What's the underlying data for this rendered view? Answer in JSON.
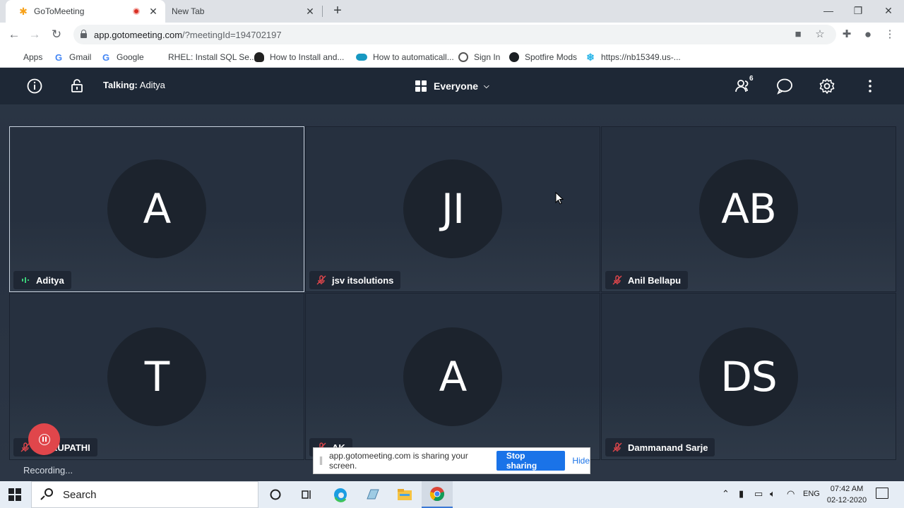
{
  "browser": {
    "tabs": [
      {
        "title": "GoToMeeting",
        "favicon": "gotomeeting-icon",
        "recording": true
      },
      {
        "title": "New Tab"
      }
    ],
    "new_tab": "+",
    "url_host": "app.gotomeeting.com",
    "url_path": "/?meetingId=194702197",
    "bookmarks": [
      {
        "label": "Apps",
        "icon": "apps-grid-icon"
      },
      {
        "label": "Gmail",
        "icon": "google-icon"
      },
      {
        "label": "Google",
        "icon": "google-icon"
      },
      {
        "label": "RHEL: Install SQL Se...",
        "icon": "windows-icon"
      },
      {
        "label": "How to Install and...",
        "icon": "linux-icon"
      },
      {
        "label": "How to automaticall...",
        "icon": "salesforce-icon"
      },
      {
        "label": "Sign In",
        "icon": "sign-in-icon"
      },
      {
        "label": "Spotfire Mods",
        "icon": "github-icon"
      },
      {
        "label": "https://nb15349.us-...",
        "icon": "snowflake-icon"
      }
    ]
  },
  "meeting": {
    "talking_label": "Talking:",
    "talking_name": "Aditya",
    "view_label": "Everyone",
    "attendee_count": "6",
    "participants": [
      {
        "initials": "A",
        "name": "Aditya",
        "muted": false,
        "talking": true
      },
      {
        "initials": "JI",
        "name": "jsv itsolutions",
        "muted": true
      },
      {
        "initials": "AB",
        "name": "Anil Bellapu",
        "muted": true
      },
      {
        "initials": "T",
        "name": "THIRUPATHI",
        "muted": true
      },
      {
        "initials": "A",
        "name": "AK",
        "muted": true
      },
      {
        "initials": "DS",
        "name": "Dammanand Sarje",
        "muted": true
      }
    ],
    "recording_status": "Recording..."
  },
  "share_notice": {
    "message": "app.gotomeeting.com is sharing your screen.",
    "stop_label": "Stop sharing",
    "hide_label": "Hide"
  },
  "taskbar": {
    "search_label": "Search",
    "language": "ENG",
    "time": "07:42 AM",
    "date": "02-12-2020"
  },
  "colors": {
    "meeting_header": "#1e2836",
    "muted_icon": "#e0464b",
    "talking_icon": "#3ccf7a",
    "accent_blue": "#1a73e8"
  }
}
